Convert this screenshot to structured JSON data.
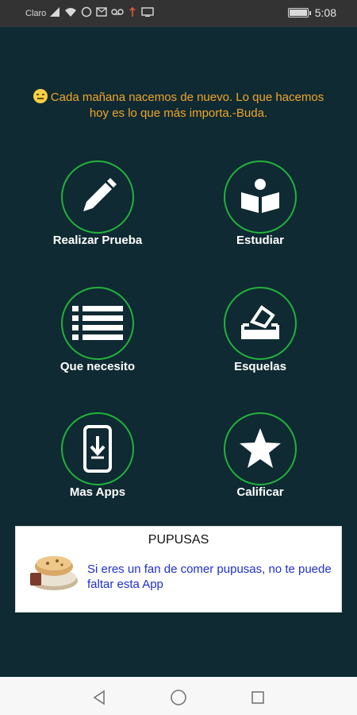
{
  "status_bar": {
    "carrier": "Claro",
    "time": "5:08",
    "icons": [
      "signal-icon",
      "wifi-icon",
      "whatsapp-icon",
      "mail-icon",
      "voicemail-icon",
      "usb-icon",
      "screen-icon"
    ]
  },
  "quote": {
    "text": "Cada mañana nacemos de nuevo. Lo que hacemos hoy es lo que más importa.-Buda.",
    "color": "#f1a52a"
  },
  "menu": {
    "realizar_prueba": "Realizar Prueba",
    "estudiar": "Estudiar",
    "que_necesito": "Que necesito",
    "esquelas": "Esquelas",
    "mas_apps": "Mas Apps",
    "calificar": "Calificar"
  },
  "ad": {
    "title": "PUPUSAS",
    "description": "Si eres un fan de comer pupusas, no te puede faltar esta App"
  },
  "colors": {
    "background": "#0f2a33",
    "circle_border": "#22b33a",
    "ad_link": "#1e2fd2"
  }
}
